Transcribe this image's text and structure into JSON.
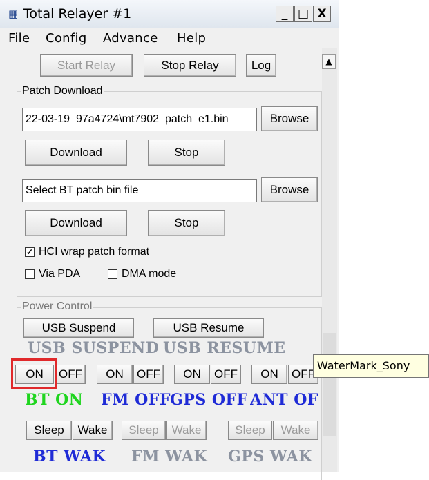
{
  "window": {
    "title": "Total Relayer #1",
    "minimize": "_",
    "maximize": "□",
    "close": "X"
  },
  "menu": [
    "File",
    "Config",
    "Advance",
    "Help"
  ],
  "toolbar": {
    "start_relay": "Start Relay",
    "stop_relay": "Stop Relay",
    "log": "Log"
  },
  "scrollbar": {
    "up_arrow": "▲"
  },
  "patch_download": {
    "legend": "Patch Download",
    "patch_path": "22-03-19_97a4724\\mt7902_patch_e1.bin",
    "browse1": "Browse",
    "download1": "Download",
    "stop1": "Stop",
    "bt_patch_placeholder": "Select BT patch bin file",
    "browse2": "Browse",
    "download2": "Download",
    "stop2": "Stop",
    "hci_wrap_label": "HCI wrap patch format",
    "hci_wrap_checked": true,
    "check_mark": "✓",
    "via_pda_label": "Via PDA",
    "dma_mode_label": "DMA mode"
  },
  "power_control": {
    "legend": "Power Control",
    "usb_suspend_btn": "USB Suspend",
    "usb_resume_btn": "USB Resume",
    "usb_suspend_text": "USB SUSPEND",
    "usb_resume_text": "USB RESUME",
    "on_label": "ON",
    "off_label": "OFF",
    "bt_status": "BT ON",
    "fm_status": "FM OFF",
    "gps_status": "GPS OFF",
    "ant_status": "ANT OFF",
    "sleep_label": "Sleep",
    "wake_label": "Wake",
    "bt_wake": "BT WAK",
    "fm_wake": "FM WAK",
    "gps_wake": "GPS WAK"
  },
  "tooltip": "WaterMark_Sony",
  "colors": {
    "gray_text": "#8c93a0",
    "green": "#1fd51f",
    "blue": "#1f2bd6",
    "highlight": "#e0292b"
  }
}
